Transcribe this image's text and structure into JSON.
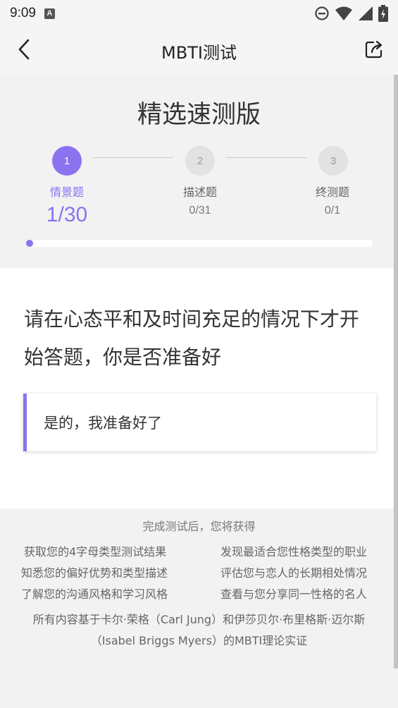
{
  "status_bar": {
    "time": "9:09",
    "notification_icon_letter": "A"
  },
  "app_bar": {
    "title": "MBTI测试"
  },
  "header": {
    "version_title": "精选速测版",
    "steps": [
      {
        "number": "1",
        "label": "情景题",
        "count": "1/30",
        "active": true
      },
      {
        "number": "2",
        "label": "描述题",
        "count": "0/31",
        "active": false
      },
      {
        "number": "3",
        "label": "终测题",
        "count": "0/1",
        "active": false
      }
    ],
    "progress_fraction": 0.02
  },
  "question": {
    "text": "请在心态平和及时间充足的情况下才开始答题，你是否准备好",
    "answer": "是的，我准备好了"
  },
  "info": {
    "title": "完成测试后，您将获得",
    "left_items": [
      "获取您的4字母类型测试结果",
      "知悉您的偏好优势和类型描述",
      "了解您的沟通风格和学习风格"
    ],
    "right_items": [
      "发现最适合您性格类型的职业",
      "评估您与恋人的长期相处情况",
      "查看与您分享同一性格的名人"
    ],
    "footer_line1": "所有内容基于卡尔·荣格（Carl Jung）和伊莎贝尔·布里格斯·迈尔斯",
    "footer_line2": "（Isabel Briggs Myers）的MBTI理论实证"
  },
  "colors": {
    "accent": "#8b73f0",
    "inactive_step": "#e2e2e2"
  }
}
